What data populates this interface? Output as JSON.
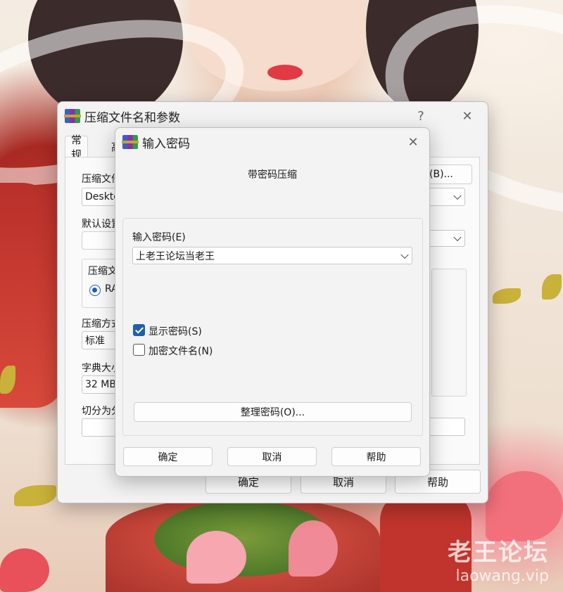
{
  "back_dialog": {
    "title": "压缩文件名和参数",
    "help_glyph": "?",
    "close_glyph": "✕",
    "tabs": [
      "常规",
      "高"
    ],
    "archive_name_label": "压缩文件",
    "archive_name_value": "Deskto",
    "browse_button": "(B)...",
    "profile_label": "默认设置",
    "format_group_label": "压缩文",
    "format_radio_label": "RA",
    "method_label": "压缩方式",
    "method_value": "标准",
    "dict_label": "字典大小",
    "dict_value": "32 MB",
    "split_label": "切分为分",
    "ok_button": "确定",
    "cancel_button": "取消",
    "help_button": "帮助"
  },
  "pwd_dialog": {
    "title": "输入密码",
    "close_glyph": "✕",
    "heading": "带密码压缩",
    "password_label": "输入密码(E)",
    "password_value": "上老王论坛当老王",
    "show_password_label": "显示密码(S)",
    "show_password_checked": true,
    "encrypt_names_label": "加密文件名(N)",
    "encrypt_names_checked": false,
    "organize_button": "整理密码(O)...",
    "ok_button": "确定",
    "cancel_button": "取消",
    "help_button": "帮助"
  },
  "watermark": {
    "cn": "老王论坛",
    "en": "laowang.vip"
  },
  "colors": {
    "accent": "#1f5fb3",
    "dialog_bg": "#f3f3f3"
  }
}
